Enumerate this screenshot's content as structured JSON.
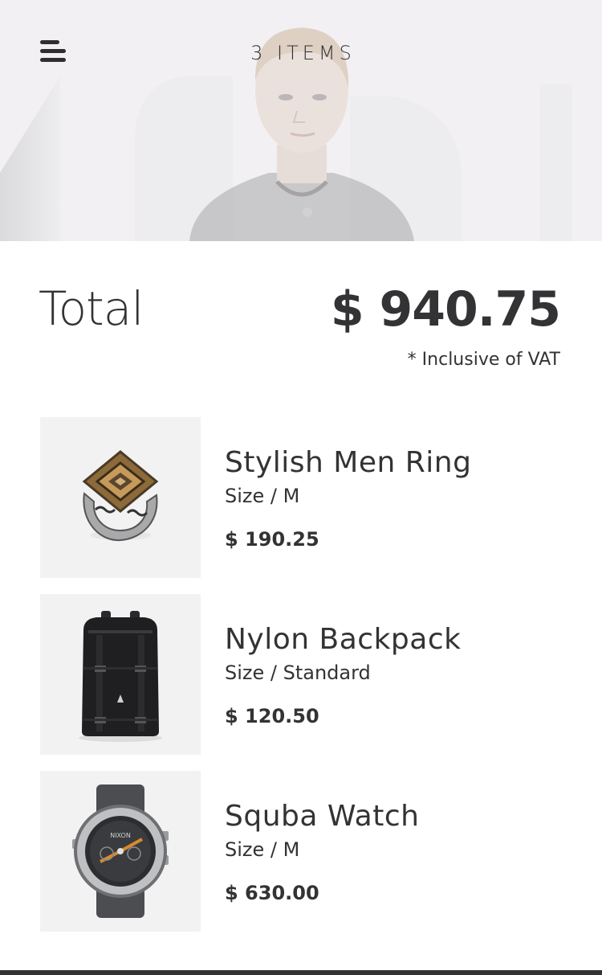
{
  "header": {
    "items_count_label": "3 ITEMS",
    "menu_icon": "menu-icon"
  },
  "summary": {
    "total_label": "Total",
    "total_amount": "$ 940.75",
    "vat_note": "* Inclusive of VAT"
  },
  "cart": {
    "items": [
      {
        "name": "Stylish Men Ring",
        "size": "Size / M",
        "price": "$ 190.25",
        "image_icon": "ring-image"
      },
      {
        "name": "Nylon Backpack",
        "size": "Size / Standard",
        "price": "$ 120.50",
        "image_icon": "backpack-image"
      },
      {
        "name": "Squba Watch",
        "size": "Size / M",
        "price": "$ 630.00",
        "image_icon": "watch-image",
        "watch_brand": "NIXON"
      }
    ]
  },
  "colors": {
    "text": "#333336",
    "hero_bg": "#f2f1f2",
    "thumb_bg": "#f2f2f3"
  }
}
